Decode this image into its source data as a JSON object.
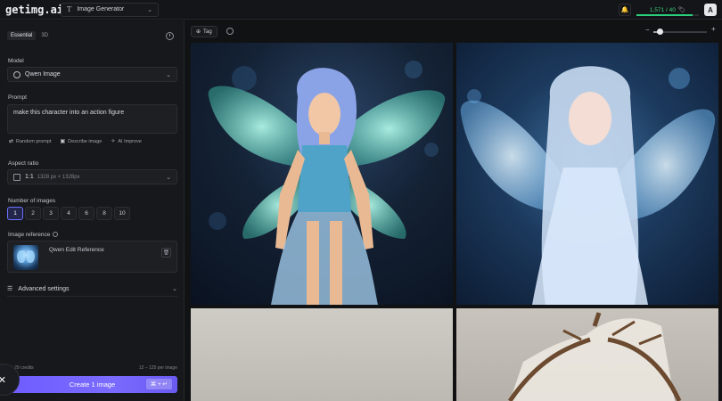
{
  "app": {
    "logo": "getimg.ai",
    "tool_select": {
      "icon": "text-t-icon",
      "label": "Image Generator"
    }
  },
  "top_right": {
    "credits_text": "1,571 / 40",
    "credits_fraction": 0.9,
    "avatar_letter": "A"
  },
  "panel": {
    "modes": [
      "Essential",
      "3D"
    ],
    "model": {
      "label": "Model",
      "value": "Qwen Image"
    },
    "prompt": {
      "label": "Prompt",
      "value": "make this character into an action figure",
      "tools": [
        "Random prompt",
        "Describe image",
        "AI Improve"
      ]
    },
    "aspect": {
      "label": "Aspect ratio",
      "value": "1:1",
      "detail": "1328 px × 1328px"
    },
    "num_images": {
      "label": "Number of images",
      "options": [
        "1",
        "2",
        "3",
        "4",
        "6",
        "8",
        "10"
      ],
      "selected": "1"
    },
    "image_reference": {
      "label": "Image reference",
      "name": "Qwen Edit Reference"
    },
    "advanced": "Advanced settings",
    "footer": {
      "left": "≈ 29 credits",
      "right": "12 – 125 per image"
    },
    "create": {
      "label": "Create 1 image",
      "shortcut": "⌘ + ↵"
    }
  },
  "main": {
    "tag_label": "Tag",
    "zoom_level": 0.12
  }
}
